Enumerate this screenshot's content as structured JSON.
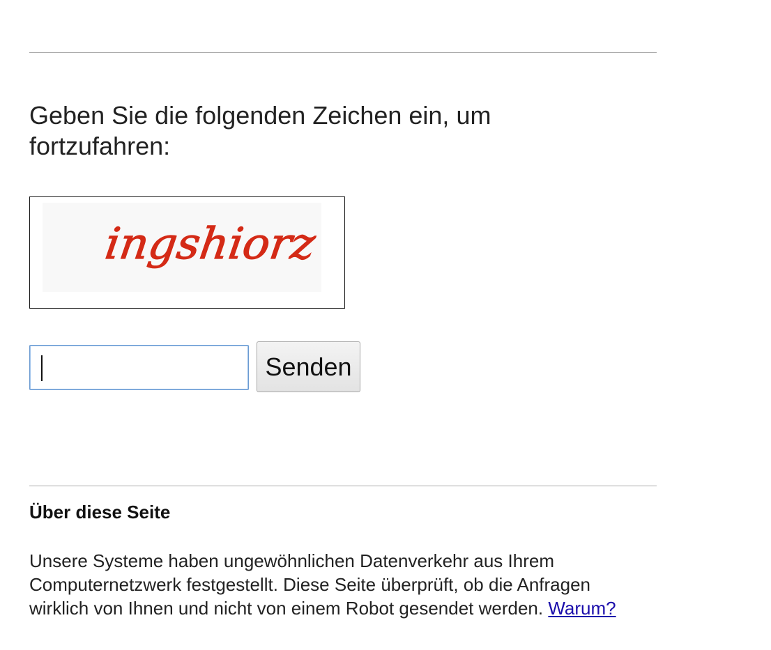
{
  "prompt": {
    "text": "Geben Sie die folgenden Zeichen ein, um fortzufahren:"
  },
  "captcha": {
    "text": "ingshiorz",
    "ink_color": "#d42a16"
  },
  "form": {
    "input_value": "",
    "submit_label": "Senden"
  },
  "about": {
    "title": "Über diese Seite",
    "body": "Unsere Systeme haben ungewöhnlichen Datenverkehr aus Ihrem Computernetzwerk festgestellt. Diese Seite überprüft, ob die Anfragen wirklich von Ihnen und nicht von einem Robot gesendet werden.",
    "link_label": "Warum?"
  },
  "colors": {
    "link": "#1a0dab",
    "rule": "#a8a8a8",
    "input_focus_border": "#6b9bd1"
  }
}
